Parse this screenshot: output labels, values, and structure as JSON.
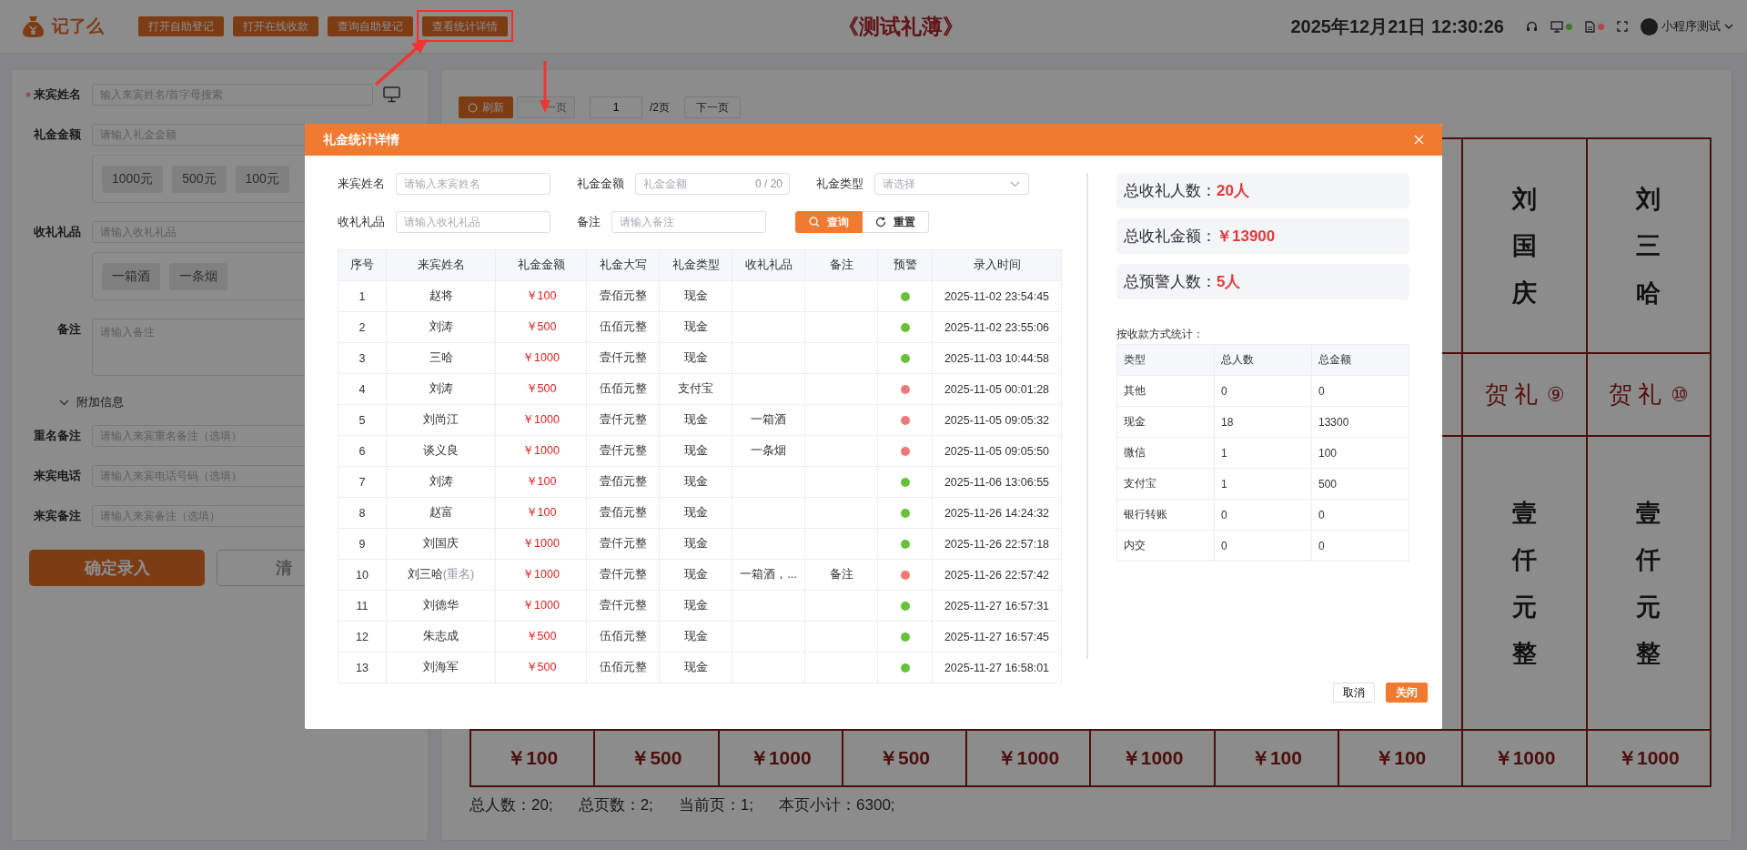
{
  "header": {
    "app_name": "记了么",
    "buttons": [
      {
        "label": "打开自助登记",
        "highlighted": false
      },
      {
        "label": "打开在线收款",
        "highlighted": false
      },
      {
        "label": "查询自助登记",
        "highlighted": false
      },
      {
        "label": "查看统计详情",
        "highlighted": true
      }
    ],
    "title": "《测试礼薄》",
    "datetime": "2025年12月21日 12:30:26",
    "indicators": [
      {
        "kind": "monitor",
        "color": "#3a7a24"
      },
      {
        "kind": "document",
        "color": "#b0484c"
      }
    ],
    "user": "小程序测试"
  },
  "entry_form": {
    "fields": [
      {
        "kind": "search",
        "label": "来宾姓名",
        "required": true,
        "placeholder": "输入来宾姓名/首字母搜索"
      },
      {
        "kind": "input",
        "label": "礼金金额",
        "required": false,
        "placeholder": "请输入礼金金额",
        "chips": [
          "1000元",
          "500元",
          "100元"
        ]
      },
      {
        "kind": "input",
        "label": "收礼礼品",
        "required": false,
        "placeholder": "请输入收礼礼品",
        "chips": [
          "一箱酒",
          "一条烟"
        ]
      },
      {
        "kind": "textarea",
        "label": "备注",
        "required": false,
        "placeholder": "请输入备注"
      }
    ],
    "extra_section": {
      "label": "附加信息",
      "expanded": true,
      "fields": [
        {
          "label": "重名备注",
          "placeholder": "请输入来宾重名备注（选填）"
        },
        {
          "label": "来宾电话",
          "placeholder": "请输入来宾电话号码（选填）"
        },
        {
          "label": "来宾备注",
          "placeholder": "请输入来宾备注（选填）"
        }
      ]
    },
    "buttons": [
      {
        "kind": "primary",
        "label": "确定录入"
      },
      {
        "kind": "plain",
        "label": "清"
      }
    ]
  },
  "gift_book": {
    "toolbar": {
      "refresh": "刷新",
      "prev": {
        "label": "一页",
        "disabled": true
      },
      "page": "1",
      "page_total": "/2页",
      "next": {
        "label": "下一页",
        "disabled": false
      }
    },
    "columns": [
      {
        "amount": "￥100"
      },
      {
        "amount": "￥500"
      },
      {
        "amount": "￥1000"
      },
      {
        "amount": "￥500"
      },
      {
        "amount": "￥1000"
      },
      {
        "amount": "￥1000"
      },
      {
        "amount": "￥100"
      },
      {
        "amount": "￥100"
      },
      {
        "name": "刘国庆",
        "gift_label": "贺礼",
        "index": "⑨",
        "amount_upper": "壹仟元整",
        "amount": "￥1000"
      },
      {
        "name": "刘三哈",
        "gift_label": "贺礼",
        "index": "⑩",
        "amount_upper": "壹仟元整",
        "amount": "￥1000"
      }
    ],
    "summary": [
      "总人数：20;",
      "总页数：2;",
      "当前页：1;",
      "本页小计：6300;"
    ]
  },
  "dialog": {
    "title": "礼金统计详情",
    "filters": [
      {
        "kind": "input",
        "label": "来宾姓名",
        "placeholder": "请输入来宾姓名"
      },
      {
        "kind": "input",
        "label": "礼金金额",
        "placeholder": "礼金金额",
        "counter": "0 / 20"
      },
      {
        "kind": "select",
        "label": "礼金类型",
        "placeholder": "请选择"
      },
      {
        "kind": "input",
        "label": "收礼礼品",
        "placeholder": "请输入收礼礼品"
      },
      {
        "kind": "input",
        "label": "备注",
        "placeholder": "请输入备注"
      }
    ],
    "search_button": "查询",
    "reset_button": "重置",
    "table": {
      "columns": [
        "序号",
        "来宾姓名",
        "礼金金额",
        "礼金大写",
        "礼金类型",
        "收礼礼品",
        "备注",
        "预警",
        "录入时间"
      ],
      "rows": [
        {
          "no": "1",
          "name": "赵将",
          "amount": "￥100",
          "amount_upper": "壹佰元整",
          "type": "现金",
          "warning": false,
          "time": "2025-11-02 23:54:45"
        },
        {
          "no": "2",
          "name": "刘涛",
          "amount": "￥500",
          "amount_upper": "伍佰元整",
          "type": "现金",
          "warning": false,
          "time": "2025-11-02 23:55:06"
        },
        {
          "no": "3",
          "name": "三哈",
          "amount": "￥1000",
          "amount_upper": "壹仟元整",
          "type": "现金",
          "warning": false,
          "time": "2025-11-03 10:44:58"
        },
        {
          "no": "4",
          "name": "刘涛",
          "amount": "￥500",
          "amount_upper": "伍佰元整",
          "type": "支付宝",
          "warning": true,
          "time": "2025-11-05 00:01:28"
        },
        {
          "no": "5",
          "name": "刘尚江",
          "amount": "￥1000",
          "amount_upper": "壹仟元整",
          "type": "现金",
          "gift": "一箱酒",
          "warning": true,
          "time": "2025-11-05 09:05:32"
        },
        {
          "no": "6",
          "name": "谈义良",
          "amount": "￥1000",
          "amount_upper": "壹仟元整",
          "type": "现金",
          "gift": "一条烟",
          "warning": true,
          "time": "2025-11-05 09:05:50"
        },
        {
          "no": "7",
          "name": "刘涛",
          "amount": "￥100",
          "amount_upper": "壹佰元整",
          "type": "现金",
          "warning": false,
          "time": "2025-11-06 13:06:55"
        },
        {
          "no": "8",
          "name": "赵富",
          "amount": "￥100",
          "amount_upper": "壹佰元整",
          "type": "现金",
          "warning": false,
          "time": "2025-11-26 14:24:32"
        },
        {
          "no": "9",
          "name": "刘国庆",
          "amount": "￥1000",
          "amount_upper": "壹仟元整",
          "type": "现金",
          "warning": false,
          "time": "2025-11-26 22:57:18"
        },
        {
          "no": "10",
          "name": "刘三哈",
          "duplicate_tag": "(重名)",
          "amount": "￥1000",
          "amount_upper": "壹仟元整",
          "type": "现金",
          "gift": "一箱酒，...",
          "remark": "备注",
          "warning": true,
          "time": "2025-11-26 22:57:42"
        },
        {
          "no": "11",
          "name": "刘德华",
          "amount": "￥1000",
          "amount_upper": "壹仟元整",
          "type": "现金",
          "warning": false,
          "time": "2025-11-27 16:57:31"
        },
        {
          "no": "12",
          "name": "朱志成",
          "amount": "￥500",
          "amount_upper": "伍佰元整",
          "type": "现金",
          "warning": false,
          "time": "2025-11-27 16:57:45"
        },
        {
          "no": "13",
          "name": "刘海军",
          "amount": "￥500",
          "amount_upper": "伍佰元整",
          "type": "现金",
          "warning": false,
          "time": "2025-11-27 16:58:01"
        }
      ]
    },
    "stats": [
      {
        "label": "总收礼人数：",
        "value": "20人"
      },
      {
        "label": "总收礼金额：",
        "value": "￥13900"
      },
      {
        "label": "总预警人数：",
        "value": "5人"
      }
    ],
    "breakdown_title": "按收款方式统计：",
    "breakdown": {
      "columns": [
        "类型",
        "总人数",
        "总金额"
      ],
      "rows": [
        [
          "其他",
          "0",
          "0"
        ],
        [
          "现金",
          "18",
          "13300"
        ],
        [
          "微信",
          "1",
          "100"
        ],
        [
          "支付宝",
          "1",
          "500"
        ],
        [
          "银行转账",
          "0",
          "0"
        ],
        [
          "内交",
          "0",
          "0"
        ]
      ]
    },
    "footer_buttons": [
      {
        "kind": "plain",
        "label": "取消"
      },
      {
        "kind": "primary",
        "label": "关闭"
      }
    ]
  }
}
